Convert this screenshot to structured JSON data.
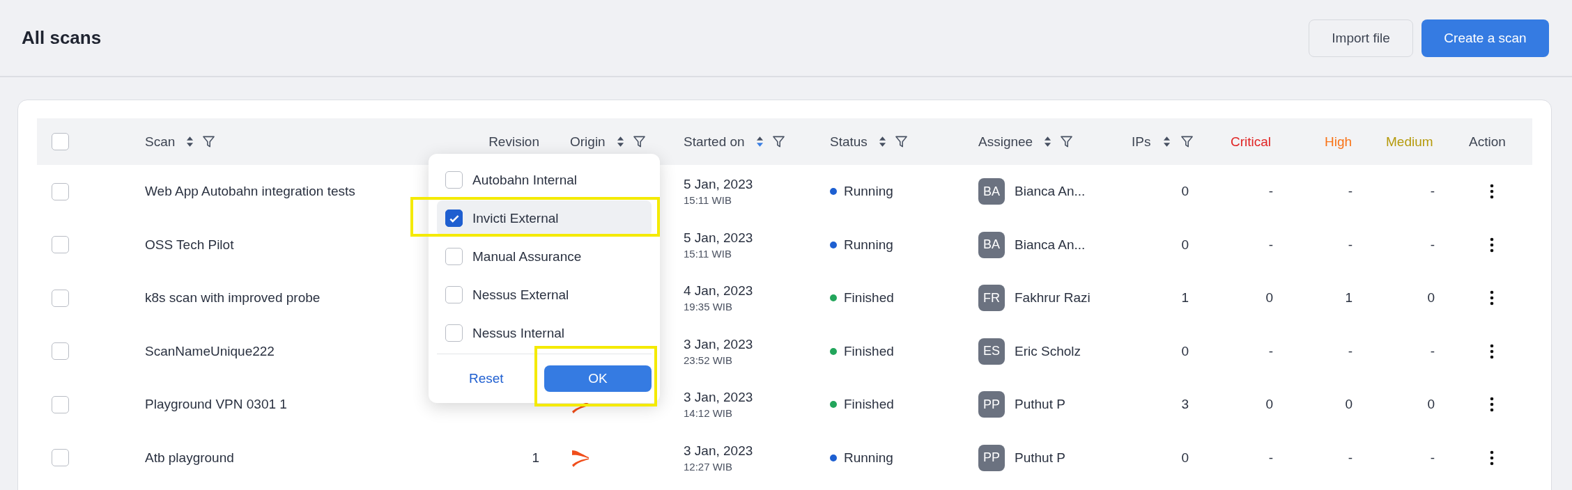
{
  "page": {
    "title": "All scans"
  },
  "actions": [
    {
      "label": "Import file",
      "kind": "secondary"
    },
    {
      "label": "Create a scan",
      "kind": "primary"
    }
  ],
  "table": {
    "select_all": {
      "checked": false
    },
    "columns": [
      {
        "label": "Scan",
        "sortable": true,
        "sorted_descending": false,
        "filter": true
      },
      {
        "label": "Revision"
      },
      {
        "label": "Origin",
        "sortable": true,
        "sorted_descending": false,
        "filter": true
      },
      {
        "label": "Started on",
        "sortable": true,
        "sorted_descending": true,
        "filter": true
      },
      {
        "label": "Status",
        "sortable": true,
        "sorted_descending": false,
        "filter": true
      },
      {
        "label": "Assignee",
        "sortable": true,
        "sorted_descending": false,
        "filter": true
      },
      {
        "label": "IPs",
        "sortable": true,
        "sorted_descending": false,
        "filter": true
      },
      {
        "label": "Critical",
        "color": "#e02424"
      },
      {
        "label": "High",
        "color": "#f97316"
      },
      {
        "label": "Medium",
        "color": "#b59a0b"
      },
      {
        "label": "Action"
      }
    ],
    "rows": [
      {
        "selected": false,
        "scan": "Web App Autobahn integration tests",
        "started_date": "5 Jan, 2023",
        "started_time": "15:11 WIB",
        "status": {
          "label": "Running",
          "color": "#1d5fd1"
        },
        "assignee": {
          "initials": "BA",
          "name": "Bianca An..."
        },
        "ips": "0",
        "critical": "-",
        "high": "-",
        "medium": "-"
      },
      {
        "selected": false,
        "scan": "OSS Tech Pilot",
        "started_date": "5 Jan, 2023",
        "started_time": "15:11 WIB",
        "status": {
          "label": "Running",
          "color": "#1d5fd1"
        },
        "assignee": {
          "initials": "BA",
          "name": "Bianca An..."
        },
        "ips": "0",
        "critical": "-",
        "high": "-",
        "medium": "-"
      },
      {
        "selected": false,
        "scan": "k8s scan with improved probe",
        "started_date": "4 Jan, 2023",
        "started_time": "19:35 WIB",
        "status": {
          "label": "Finished",
          "color": "#22a55b"
        },
        "assignee": {
          "initials": "FR",
          "name": "Fakhrur Razi"
        },
        "ips": "1",
        "critical": "0",
        "high": "1",
        "medium": "0"
      },
      {
        "selected": false,
        "scan": "ScanNameUnique222",
        "started_date": "3 Jan, 2023",
        "started_time": "23:52 WIB",
        "status": {
          "label": "Finished",
          "color": "#22a55b"
        },
        "assignee": {
          "initials": "ES",
          "name": "Eric Scholz"
        },
        "ips": "0",
        "critical": "-",
        "high": "-",
        "medium": "-"
      },
      {
        "selected": false,
        "scan": "Playground VPN 0301 1",
        "started_date": "3 Jan, 2023",
        "started_time": "14:12 WIB",
        "status": {
          "label": "Finished",
          "color": "#22a55b"
        },
        "assignee": {
          "initials": "PP",
          "name": "Puthut P"
        },
        "ips": "3",
        "critical": "0",
        "high": "0",
        "medium": "0"
      },
      {
        "selected": false,
        "scan": "Atb playground",
        "revision": "1",
        "started_date": "3 Jan, 2023",
        "started_time": "12:27 WIB",
        "status": {
          "label": "Running",
          "color": "#1d5fd1"
        },
        "assignee": {
          "initials": "PP",
          "name": "Puthut P"
        },
        "ips": "0",
        "critical": "-",
        "high": "-",
        "medium": "-"
      }
    ]
  },
  "origin_filter": {
    "options": [
      {
        "label": "Autobahn Internal",
        "checked": false,
        "selected": false
      },
      {
        "label": "Invicti External",
        "checked": true,
        "selected": true
      },
      {
        "label": "Manual Assurance",
        "checked": false,
        "selected": false
      },
      {
        "label": "Nessus External",
        "checked": false,
        "selected": false
      },
      {
        "label": "Nessus Internal",
        "checked": false,
        "selected": false
      }
    ],
    "reset": "Reset",
    "ok": "OK"
  }
}
